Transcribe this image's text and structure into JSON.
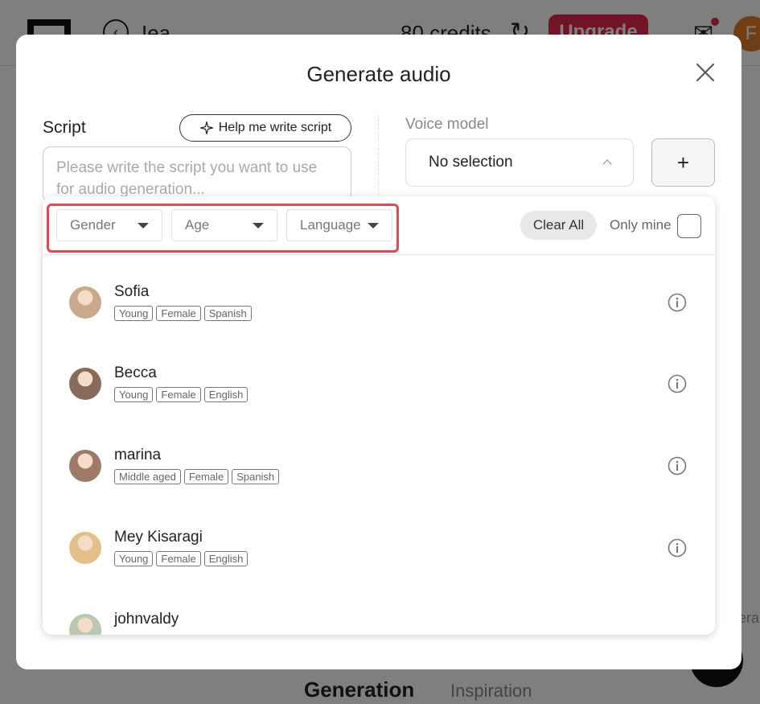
{
  "background": {
    "app_title": "Iea",
    "credits": "80 credits",
    "upgrade_label": "Upgrade",
    "avatar_initial": "F",
    "tabs": [
      "Generation",
      "Inspiration"
    ],
    "right_edge_text": "era"
  },
  "modal": {
    "title": "Generate audio",
    "script": {
      "label": "Script",
      "help_button": "Help me write script",
      "placeholder": "Please write the script you want to use for audio generation..."
    },
    "voice_model": {
      "label": "Voice model",
      "selected": "No selection",
      "add_label": "+"
    },
    "filters": {
      "gender": "Gender",
      "age": "Age",
      "language": "Language",
      "clear_all": "Clear All",
      "only_mine": "Only mine"
    },
    "voices": [
      {
        "name": "Sofia",
        "tags": [
          "Young",
          "Female",
          "Spanish"
        ],
        "avatar_color": "#c9a98a"
      },
      {
        "name": "Becca",
        "tags": [
          "Young",
          "Female",
          "English"
        ],
        "avatar_color": "#8a6a5a"
      },
      {
        "name": "marina",
        "tags": [
          "Middle aged",
          "Female",
          "Spanish"
        ],
        "avatar_color": "#a07a68"
      },
      {
        "name": "Mey Kisaragi",
        "tags": [
          "Young",
          "Female",
          "English"
        ],
        "avatar_color": "#e3c08a"
      },
      {
        "name": "johnvaldy",
        "tags": [],
        "avatar_color": "#b9c9b0"
      }
    ]
  }
}
